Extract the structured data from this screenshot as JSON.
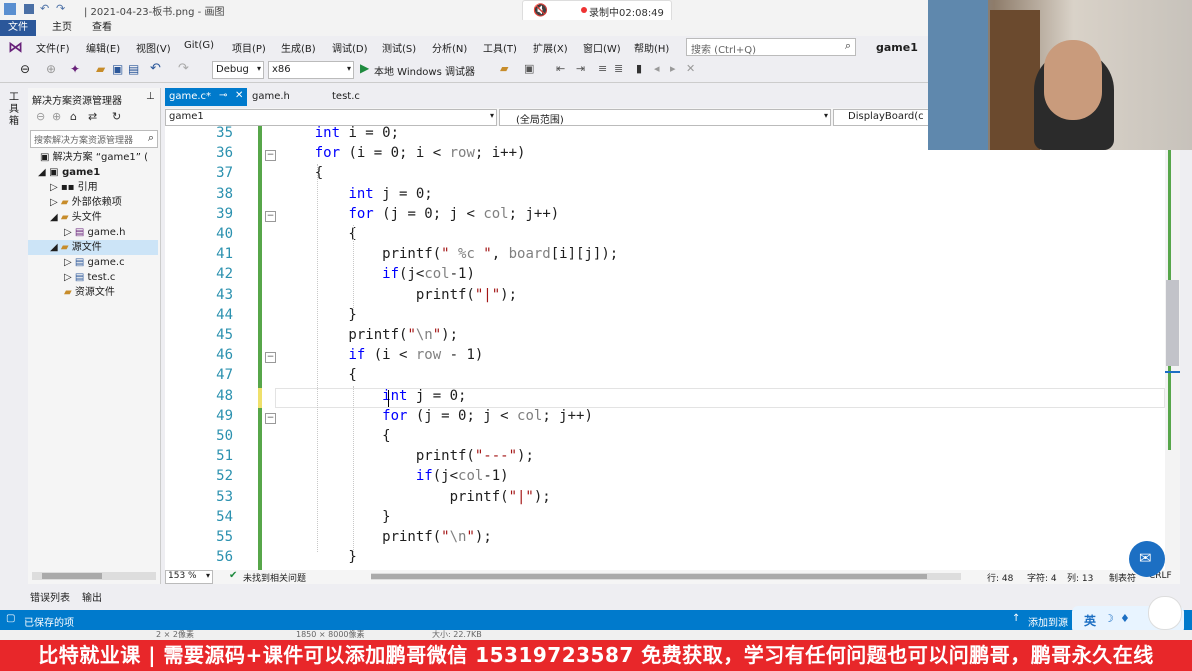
{
  "paint": {
    "title": "| 2021-04-23-板书.png - 画图",
    "recording": "录制中02:08:49",
    "tabs": [
      "文件",
      "主页",
      "查看"
    ],
    "status_items": [
      "2 × 2像素",
      "1850 × 8000像素",
      "大小: 22.7KB"
    ]
  },
  "vs": {
    "menu": [
      "文件(F)",
      "编辑(E)",
      "视图(V)",
      "Git(G)",
      "项目(P)",
      "生成(B)",
      "调试(D)",
      "测试(S)",
      "分析(N)",
      "工具(T)",
      "扩展(X)",
      "窗口(W)",
      "帮助(H)"
    ],
    "search_placeholder": "搜索 (Ctrl+Q)",
    "project_title": "game1",
    "toolbar": {
      "config": "Debug",
      "platform": "x86",
      "run_label": "本地 Windows 调试器"
    },
    "side_label": "工具箱"
  },
  "solution_explorer": {
    "title": "解决方案资源管理器",
    "search_placeholder": "搜索解决方案资源管理器",
    "items": [
      {
        "label": "解决方案 “game1” (",
        "indent": 0,
        "bold": false
      },
      {
        "label": "game1",
        "indent": 1,
        "bold": true
      },
      {
        "label": "引用",
        "indent": 2,
        "bold": false
      },
      {
        "label": "外部依赖项",
        "indent": 2,
        "bold": false
      },
      {
        "label": "头文件",
        "indent": 2,
        "bold": false
      },
      {
        "label": "game.h",
        "indent": 3,
        "bold": false
      },
      {
        "label": "源文件",
        "indent": 2,
        "bold": false,
        "selected": true
      },
      {
        "label": "game.c",
        "indent": 3,
        "bold": false
      },
      {
        "label": "test.c",
        "indent": 3,
        "bold": false
      },
      {
        "label": "资源文件",
        "indent": 2,
        "bold": false
      }
    ]
  },
  "editor": {
    "tabs": [
      {
        "label": "game.c*",
        "active": true
      },
      {
        "label": "game.h",
        "active": false
      },
      {
        "label": "test.c",
        "active": false
      }
    ],
    "nav": {
      "project": "game1",
      "scope": "(全局范围)",
      "member": "DisplayBoard(c"
    },
    "lines": [
      {
        "no": "35",
        "text": "    int i = 0;"
      },
      {
        "no": "36",
        "text": "    for (i = 0; i < row; i++)"
      },
      {
        "no": "37",
        "text": "    {"
      },
      {
        "no": "38",
        "text": "        int j = 0;"
      },
      {
        "no": "39",
        "text": "        for (j = 0; j < col; j++)"
      },
      {
        "no": "40",
        "text": "        {"
      },
      {
        "no": "41",
        "text": "            printf(\" %c \", board[i][j]);"
      },
      {
        "no": "42",
        "text": "            if(j<col-1)"
      },
      {
        "no": "43",
        "text": "                printf(\"|\");"
      },
      {
        "no": "44",
        "text": "        }"
      },
      {
        "no": "45",
        "text": "        printf(\"\\n\");"
      },
      {
        "no": "46",
        "text": "        if (i < row - 1)"
      },
      {
        "no": "47",
        "text": "        {"
      },
      {
        "no": "48",
        "text": "            int j = 0;"
      },
      {
        "no": "49",
        "text": "            for (j = 0; j < col; j++)"
      },
      {
        "no": "50",
        "text": "            {"
      },
      {
        "no": "51",
        "text": "                printf(\"---\");"
      },
      {
        "no": "52",
        "text": "                if(j<col-1)"
      },
      {
        "no": "53",
        "text": "                    printf(\"|\");"
      },
      {
        "no": "54",
        "text": "            }"
      },
      {
        "no": "55",
        "text": "            printf(\"\\n\");"
      },
      {
        "no": "56",
        "text": "        }"
      }
    ],
    "zoom": "153 %",
    "issues": "未找到相关问题",
    "row": "行: 48",
    "char": "字符: 4",
    "col": "列: 13",
    "tab_mode": "制表符",
    "eol": "CRLF"
  },
  "bottom_tabs": [
    "错误列表",
    "输出"
  ],
  "status": {
    "saved": "已保存的项",
    "source_control": "添加到源"
  },
  "banner": "比特就业课 | 需要源码+课件可以添加鹏哥微信 15319723587 免费获取，学习有任何问题也可以问鹏哥，鹏哥永久在线",
  "ime": "英"
}
